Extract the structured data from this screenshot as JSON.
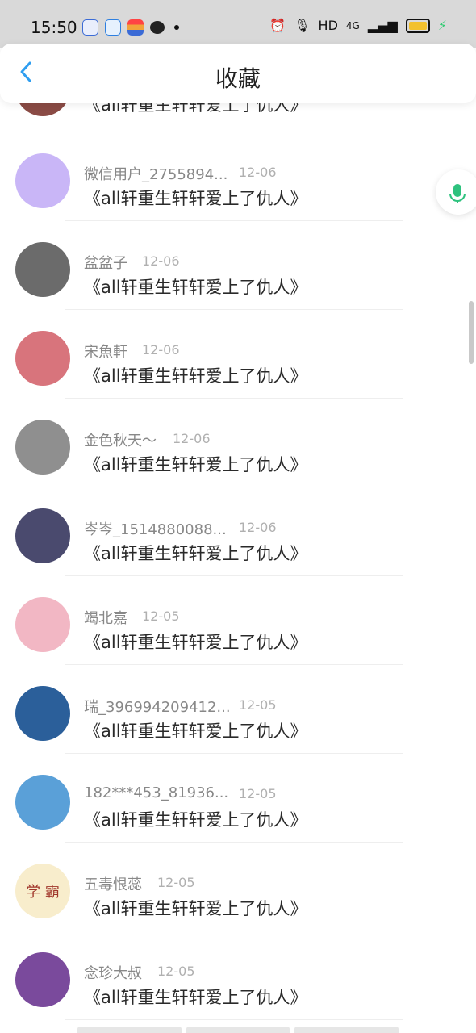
{
  "status_bar": {
    "time": "15:50",
    "apps": [
      {
        "icon": "baidu-icon",
        "color": "#3b6bd6"
      },
      {
        "icon": "browser-icon",
        "color": "#2d7fe0"
      },
      {
        "icon": "stripes-icon",
        "color": "#f2a33a"
      },
      {
        "icon": "wechat-icon",
        "color": "#222222"
      }
    ],
    "right_text": "HD",
    "network": "4G",
    "battery_color": "#f2c12e"
  },
  "header": {
    "title": "收藏",
    "back_icon": "chevron-left-icon",
    "accent": "#2f9ef0"
  },
  "partial_row": {
    "content": "《all轩重生轩轩爱上了仇人》"
  },
  "items": [
    {
      "name": "微信用户_2755894...",
      "date": "12-06",
      "content": "《all轩重生轩轩爱上了仇人》",
      "avatar_color": "#c9b6f7"
    },
    {
      "name": "盆盆子",
      "date": "12-06",
      "content": "《all轩重生轩轩爱上了仇人》",
      "avatar_color": "#6b6b6b"
    },
    {
      "name": "宋魚軒",
      "date": "12-06",
      "content": "《all轩重生轩轩爱上了仇人》",
      "avatar_color": "#d8747c"
    },
    {
      "name": "金色秋天〜",
      "date": "12-06",
      "content": "《all轩重生轩轩爱上了仇人》",
      "avatar_color": "#8f8f8f"
    },
    {
      "name": "岑岑_1514880088...",
      "date": "12-06",
      "content": "《all轩重生轩轩爱上了仇人》",
      "avatar_color": "#4a4a6e"
    },
    {
      "name": "竭北嘉",
      "date": "12-05",
      "content": "《all轩重生轩轩爱上了仇人》",
      "avatar_color": "#f2b7c4"
    },
    {
      "name": "瑞_396994209412...",
      "date": "12-05",
      "content": "《all轩重生轩轩爱上了仇人》",
      "avatar_color": "#2b5f9a"
    },
    {
      "name": "182***453_81936...",
      "date": "12-05",
      "content": "《all轩重生轩轩爱上了仇人》",
      "avatar_color": "#5aa0d8"
    },
    {
      "name": "五毒恨蕊",
      "date": "12-05",
      "content": "《all轩重生轩轩爱上了仇人》",
      "avatar_color": "#f8edcc",
      "avatar_text": "学 霸"
    },
    {
      "name": "念珍大叔",
      "date": "12-05",
      "content": "《all轩重生轩轩爱上了仇人》",
      "avatar_color": "#7a4a9c"
    }
  ],
  "floating": {
    "mic_icon": "microphone-icon",
    "mic_color": "#2ec27e"
  }
}
